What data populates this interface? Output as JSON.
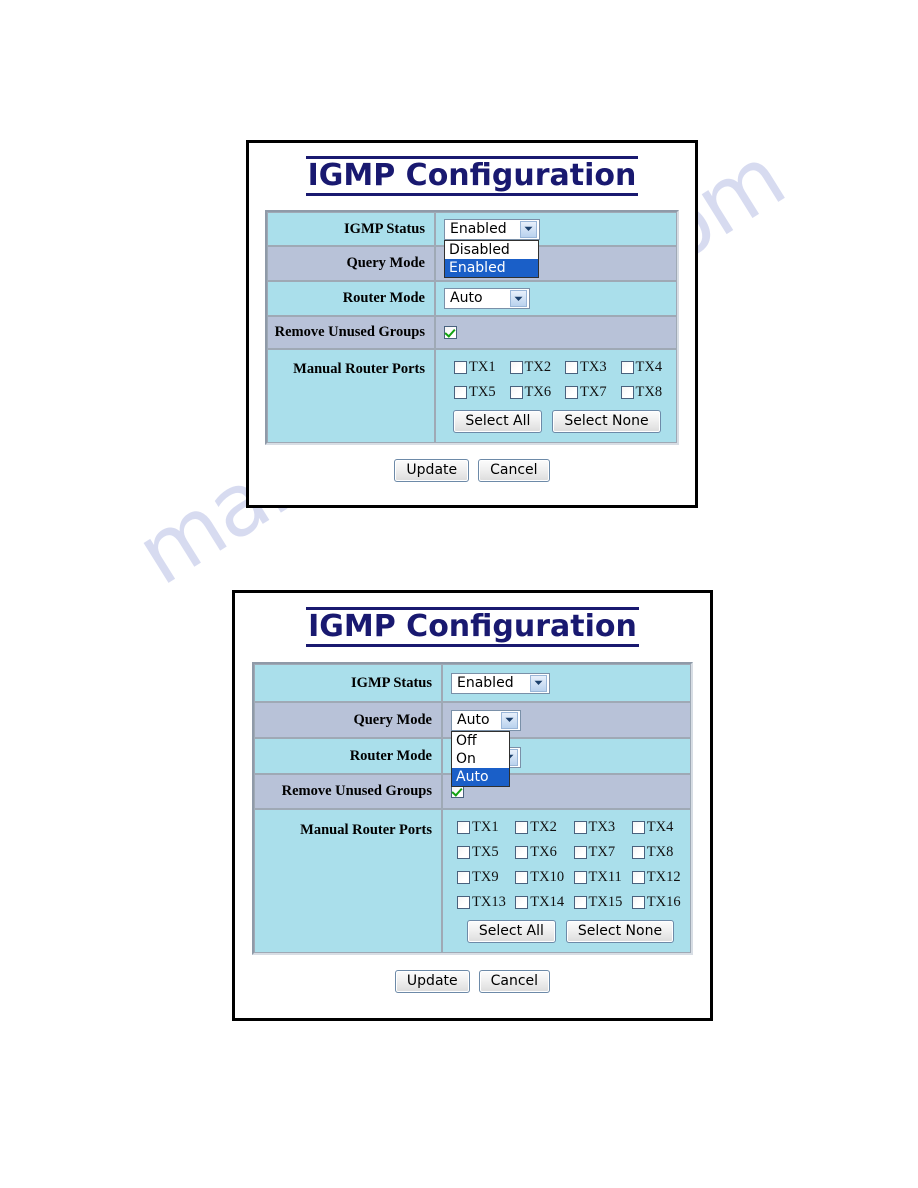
{
  "watermark": {
    "text": "manualphive.com"
  },
  "panels": [
    {
      "id": "panel-1",
      "title": "IGMP Configuration",
      "rows": [
        {
          "label": "IGMP Status",
          "control": "select",
          "value": "Enabled"
        },
        {
          "label": "Query Mode",
          "control": "none",
          "value": ""
        },
        {
          "label": "Router Mode",
          "control": "select",
          "value": "Auto"
        },
        {
          "label": "Remove Unused Groups",
          "control": "checkbox",
          "checked": true
        },
        {
          "label": "Manual Router Ports",
          "control": "ports"
        }
      ],
      "open_dropdown": {
        "for": "IGMP Status",
        "options": [
          "Disabled",
          "Enabled"
        ],
        "highlighted": "Enabled"
      },
      "ports": [
        "TX1",
        "TX2",
        "TX3",
        "TX4",
        "TX5",
        "TX6",
        "TX7",
        "TX8"
      ],
      "ports_checked": [],
      "select_all_label": "Select All",
      "select_none_label": "Select None",
      "update_label": "Update",
      "cancel_label": "Cancel"
    },
    {
      "id": "panel-2",
      "title": "IGMP Configuration",
      "rows": [
        {
          "label": "IGMP Status",
          "control": "select",
          "value": "Enabled"
        },
        {
          "label": "Query Mode",
          "control": "select",
          "value": "Auto"
        },
        {
          "label": "Router Mode",
          "control": "select",
          "value": ""
        },
        {
          "label": "Remove Unused Groups",
          "control": "checkbox",
          "checked": true
        },
        {
          "label": "Manual Router Ports",
          "control": "ports"
        }
      ],
      "open_dropdown": {
        "for": "Query Mode",
        "options": [
          "Off",
          "On",
          "Auto"
        ],
        "highlighted": "Auto"
      },
      "ports": [
        "TX1",
        "TX2",
        "TX3",
        "TX4",
        "TX5",
        "TX6",
        "TX7",
        "TX8",
        "TX9",
        "TX10",
        "TX11",
        "TX12",
        "TX13",
        "TX14",
        "TX15",
        "TX16"
      ],
      "ports_checked": [],
      "select_all_label": "Select All",
      "select_none_label": "Select None",
      "update_label": "Update",
      "cancel_label": "Cancel"
    }
  ],
  "colors": {
    "title": "#191970",
    "row_light": "#aadfeb",
    "row_dark": "#b8c2d8",
    "dropdown_highlight": "#1a5fc8",
    "check_green": "#11a211",
    "panel_border": "#000000"
  }
}
